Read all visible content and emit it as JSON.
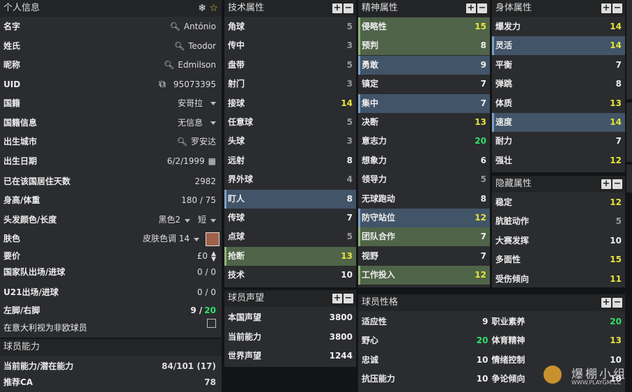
{
  "personal": {
    "title": "个人信息",
    "rows": [
      {
        "label": "名字",
        "value": "António"
      },
      {
        "label": "姓氏",
        "value": "Teodor"
      },
      {
        "label": "昵称",
        "value": "Edmilson"
      },
      {
        "label": "UID",
        "value": "95073395"
      },
      {
        "label": "国籍",
        "value": "安哥拉"
      },
      {
        "label": "国籍信息",
        "value": "无信息"
      },
      {
        "label": "出生城市",
        "value": "罗安达"
      },
      {
        "label": "出生日期",
        "value": "6/2/1999"
      },
      {
        "label": "已在该国居住天数",
        "value": "2982"
      },
      {
        "label": "身高/体重",
        "value": "180 / 75"
      },
      {
        "label": "头发颜色/长度",
        "value": "黑色2",
        "value2": "短"
      },
      {
        "label": "肤色",
        "value": "皮肤色调 14"
      },
      {
        "label": "要价",
        "value": "£0"
      },
      {
        "label": "国家队出场/进球",
        "value": "0 / 0"
      },
      {
        "label": "U21出场/进球",
        "value": "0 / 0"
      },
      {
        "label": "左脚/右脚",
        "value_left": "9 /",
        "value_right": "20"
      },
      {
        "label": "在意大利视为非欧球员",
        "value": ""
      }
    ]
  },
  "ability": {
    "title": "球员能力",
    "rows": [
      {
        "label": "当前能力/潜在能力",
        "value": "84/101 (17)"
      },
      {
        "label": "推荐CA",
        "value": "78"
      }
    ]
  },
  "technical": {
    "title": "技术属性",
    "rows": [
      {
        "label": "角球",
        "value": "5",
        "tone": "gray"
      },
      {
        "label": "传中",
        "value": "3",
        "tone": "gray"
      },
      {
        "label": "盘带",
        "value": "5",
        "tone": "gray"
      },
      {
        "label": "射门",
        "value": "3",
        "tone": "gray"
      },
      {
        "label": "接球",
        "value": "14",
        "tone": "yellow"
      },
      {
        "label": "任意球",
        "value": "5",
        "tone": "gray"
      },
      {
        "label": "头球",
        "value": "3",
        "tone": "gray"
      },
      {
        "label": "远射",
        "value": "8",
        "tone": "white"
      },
      {
        "label": "界外球",
        "value": "4",
        "tone": "gray"
      },
      {
        "label": "盯人",
        "value": "8",
        "tone": "white",
        "hl": "blue"
      },
      {
        "label": "传球",
        "value": "7",
        "tone": "white"
      },
      {
        "label": "点球",
        "value": "5",
        "tone": "gray"
      },
      {
        "label": "抢断",
        "value": "13",
        "tone": "yellow",
        "hl": "green"
      },
      {
        "label": "技术",
        "value": "10",
        "tone": "white"
      }
    ]
  },
  "mental": {
    "title": "精神属性",
    "rows": [
      {
        "label": "侵略性",
        "value": "15",
        "tone": "yellow",
        "hl": "green"
      },
      {
        "label": "预判",
        "value": "8",
        "tone": "white",
        "hl": "green"
      },
      {
        "label": "勇敢",
        "value": "9",
        "tone": "white",
        "hl": "blue"
      },
      {
        "label": "镇定",
        "value": "7",
        "tone": "white"
      },
      {
        "label": "集中",
        "value": "7",
        "tone": "white",
        "hl": "blue"
      },
      {
        "label": "决断",
        "value": "13",
        "tone": "yellow"
      },
      {
        "label": "意志力",
        "value": "20",
        "tone": "green"
      },
      {
        "label": "想象力",
        "value": "6",
        "tone": "white"
      },
      {
        "label": "领导力",
        "value": "5",
        "tone": "gray"
      },
      {
        "label": "无球跑动",
        "value": "8",
        "tone": "white"
      },
      {
        "label": "防守站位",
        "value": "12",
        "tone": "yellow",
        "hl": "blue"
      },
      {
        "label": "团队合作",
        "value": "7",
        "tone": "white",
        "hl": "green"
      },
      {
        "label": "视野",
        "value": "7",
        "tone": "white"
      },
      {
        "label": "工作投入",
        "value": "12",
        "tone": "yellow",
        "hl": "green"
      }
    ]
  },
  "physical": {
    "title": "身体属性",
    "rows": [
      {
        "label": "爆发力",
        "value": "14",
        "tone": "yellow"
      },
      {
        "label": "灵活",
        "value": "14",
        "tone": "yellow",
        "hl": "blue"
      },
      {
        "label": "平衡",
        "value": "7",
        "tone": "white"
      },
      {
        "label": "弹跳",
        "value": "8",
        "tone": "white"
      },
      {
        "label": "体质",
        "value": "13",
        "tone": "yellow"
      },
      {
        "label": "速度",
        "value": "14",
        "tone": "yellow",
        "hl": "blue"
      },
      {
        "label": "耐力",
        "value": "7",
        "tone": "white"
      },
      {
        "label": "强壮",
        "value": "12",
        "tone": "yellow"
      }
    ]
  },
  "hidden": {
    "title": "隐藏属性",
    "rows": [
      {
        "label": "稳定",
        "value": "12",
        "tone": "yellow"
      },
      {
        "label": "肮脏动作",
        "value": "5",
        "tone": "gray"
      },
      {
        "label": "大赛发挥",
        "value": "10",
        "tone": "white"
      },
      {
        "label": "多面性",
        "value": "15",
        "tone": "yellow"
      },
      {
        "label": "受伤倾向",
        "value": "11",
        "tone": "yellow"
      }
    ]
  },
  "reputation": {
    "title": "球员声望",
    "rows": [
      {
        "label": "本国声望",
        "value": "3800"
      },
      {
        "label": "当前能力",
        "value": "3800"
      },
      {
        "label": "世界声望",
        "value": "1244"
      }
    ]
  },
  "personality": {
    "title": "球员性格",
    "rows": [
      {
        "label": "适应性",
        "value": "9",
        "tone": "white",
        "label2": "职业素养",
        "value2": "20",
        "tone2": "green"
      },
      {
        "label": "野心",
        "value": "20",
        "tone": "green",
        "label2": "体育精神",
        "value2": "13",
        "tone2": "yellow"
      },
      {
        "label": "忠诚",
        "value": "10",
        "tone": "white",
        "label2": "情绪控制",
        "value2": "10",
        "tone2": "white"
      },
      {
        "label": "抗压能力",
        "value": "10",
        "tone": "white",
        "label2": "争论倾向",
        "value2": "10",
        "tone2": "white"
      }
    ]
  },
  "buttons": {
    "plus": "+",
    "minus": "−"
  },
  "watermark": {
    "text": "爆棚小组",
    "url": "WWW.PLAYGM.CC"
  }
}
